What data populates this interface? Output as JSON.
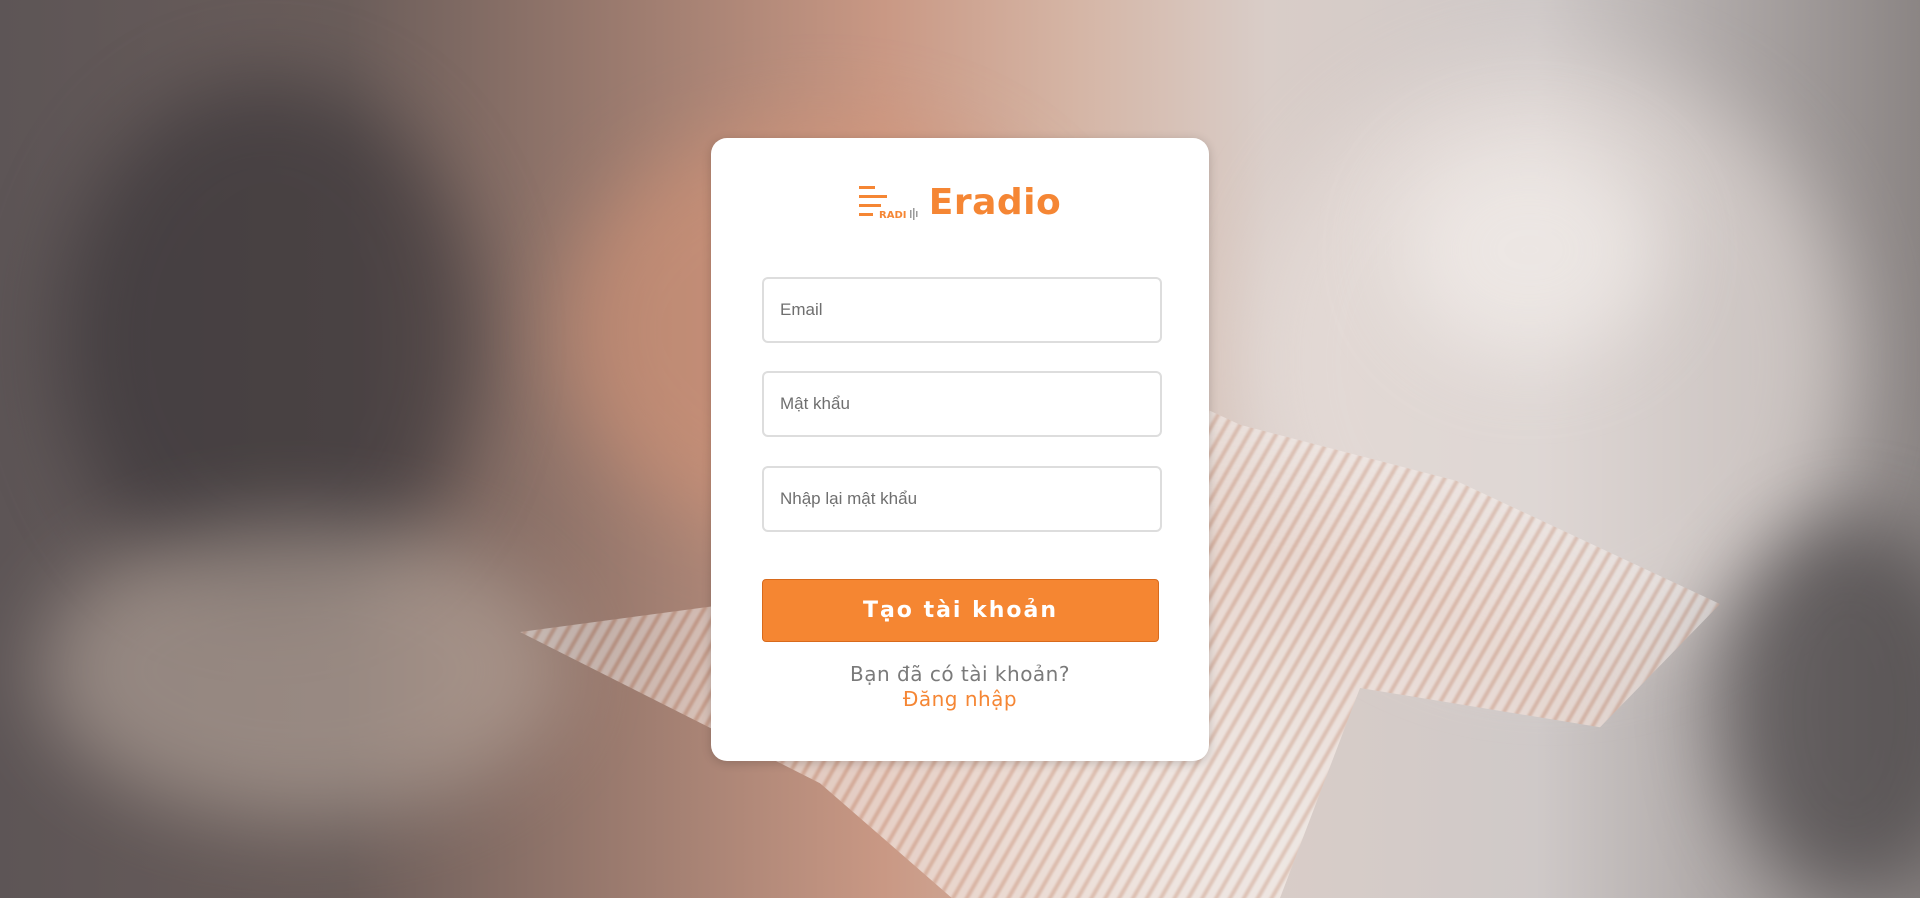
{
  "brand": {
    "name": "Eradio",
    "logo_text": "RADI",
    "accent_color": "#f58634"
  },
  "form": {
    "email_placeholder": "Email",
    "password_placeholder": "Mật khẩu",
    "confirm_password_placeholder": "Nhập lại mật khẩu",
    "submit_label": "Tạo tài khoản"
  },
  "footer": {
    "prompt": "Bạn đã có tài khoản?",
    "login_label": "Đăng nhập"
  }
}
